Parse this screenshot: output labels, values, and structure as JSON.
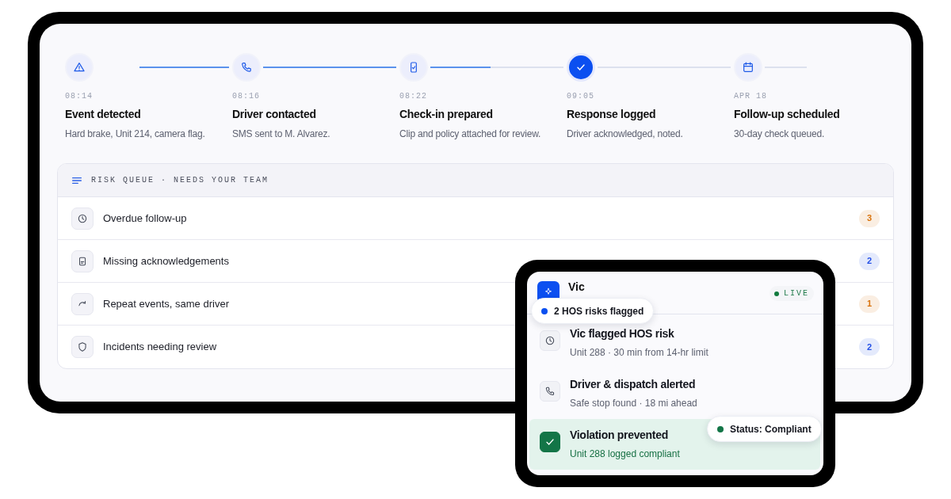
{
  "timeline": [
    {
      "time": "08:14",
      "title": "Event detected",
      "detail": "Hard brake, Unit 214, camera flag.",
      "current": false,
      "level": 1
    },
    {
      "time": "08:16",
      "title": "Driver contacted",
      "detail": "SMS sent to M. Alvarez.",
      "current": false,
      "level": 1
    },
    {
      "time": "08:22",
      "title": "Check-in prepared",
      "detail": "Clip and policy attached for review.",
      "current": false,
      "level": 0.45
    },
    {
      "time": "09:05",
      "title": "Response logged",
      "detail": "Driver acknowledged, noted.",
      "current": true,
      "level": 0
    },
    {
      "time": "APR 18",
      "title": "Follow-up scheduled",
      "detail": "30-day check queued.",
      "current": false,
      "level": 0
    }
  ],
  "queue": {
    "title": "RISK QUEUE · NEEDS YOUR TEAM",
    "rows": [
      {
        "label": "Overdue follow-up",
        "count": "3",
        "color": "#d9730d"
      },
      {
        "label": "Missing acknowledgements",
        "count": "2",
        "color": "#2450e6"
      },
      {
        "label": "Repeat events, same driver",
        "count": "1",
        "color": "#d9730d"
      },
      {
        "label": "Incidents needing review",
        "count": "2",
        "color": "#2450e6"
      }
    ]
  },
  "assistant": {
    "name": "Vic",
    "live": "LIVE",
    "flag_pill": "2 HOS risks flagged",
    "items": [
      {
        "kind": "neutral",
        "title": "Vic flagged HOS risk",
        "detail": "Unit 288 · 30 min from 14-hr limit"
      },
      {
        "kind": "neutral",
        "title": "Driver & dispatch alerted",
        "detail": "Safe stop found · 18 mi ahead"
      },
      {
        "kind": "success",
        "title": "Violation prevented",
        "detail": "Unit 288 logged compliant"
      }
    ],
    "status_pill": "Status: Compliant"
  }
}
